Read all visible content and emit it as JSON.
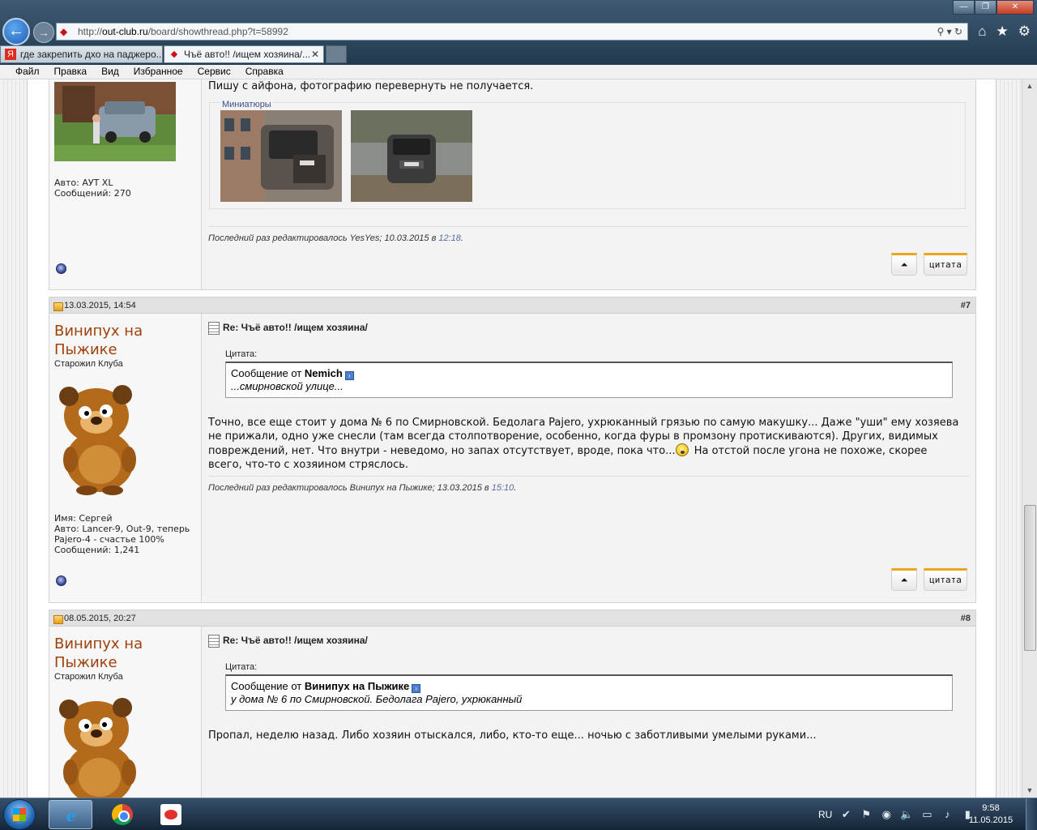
{
  "browser": {
    "url_base": "http://",
    "url_domain": "out-club.ru",
    "url_path": "/board/showthread.php?t=58992",
    "tabs": [
      {
        "label": "где закрепить дхо на паджеро...",
        "icon": "Я"
      },
      {
        "label": "Чъё авто!! /ищем хозяина/...",
        "close": "✕"
      }
    ],
    "menu": [
      "Файл",
      "Правка",
      "Вид",
      "Избранное",
      "Сервис",
      "Справка"
    ]
  },
  "posts": [
    {
      "first_line": "Пишу с айфона, фотографию перевернуть не получается.",
      "user_info": [
        "Авто: АУТ XL",
        "Сообщений: 270"
      ],
      "attachments_label": "Миниатюры",
      "edit_note": "Последний раз редактировалось YesYes; 10.03.2015 в ",
      "edit_time": "12:18",
      "edit_dot": ".",
      "quote_btn": "цитата"
    },
    {
      "date": "13.03.2015, 14:54",
      "num": "#7",
      "username": "Винипух на Пыжике",
      "user_title": "Старожил Клуба",
      "user_info": [
        "Имя: Сергей",
        "Авто: Lancer-9, Out-9, теперь",
        "Pajero-4 - счастье 100%",
        "Сообщений: 1,241"
      ],
      "title": "Re: Чъё авто!! /ищем хозяина/",
      "quote_label": "Цитата:",
      "quote_from": "Сообщение от ",
      "quote_author": "Nemich",
      "quote_text": "...смирновской улице...",
      "text_before": "Точно, все еще стоит у дома № 6 по Смирновской. Бедолага Pajero, ухрюканный грязью по самую макушку... Даже \"уши\" ему хозяева не прижали, одно уже снесли (там всегда столпотворение, особенно, когда фуры в промзону протискиваются). Других, видимых повреждений, нет. Что внутри - неведомо, но запах отсутствует, вроде, пока что...",
      "text_after": " На отстой после угона не похоже, скорее всего, что-то с хозяином стряслось.",
      "edit_note": "Последний раз редактировалось Винипух на Пыжике; 13.03.2015 в ",
      "edit_time": "15:10",
      "edit_dot": ".",
      "quote_btn": "цитата"
    },
    {
      "date": "08.05.2015, 20:27",
      "num": "#8",
      "username": "Винипух на Пыжике",
      "user_title": "Старожил Клуба",
      "title": "Re: Чъё авто!! /ищем хозяина/",
      "quote_label": "Цитата:",
      "quote_from": "Сообщение от ",
      "quote_author": "Винипух на Пыжике",
      "quote_text": "у дома № 6 по Смирновской. Бедолага Pajero, ухрюканный",
      "text": "Пропал, неделю назад. Либо хозяин отыскался, либо, кто-то еще... ночью с заботливыми умелыми руками..."
    }
  ],
  "taskbar": {
    "lang": "RU",
    "time": "9:58",
    "date": "11.05.2015"
  }
}
